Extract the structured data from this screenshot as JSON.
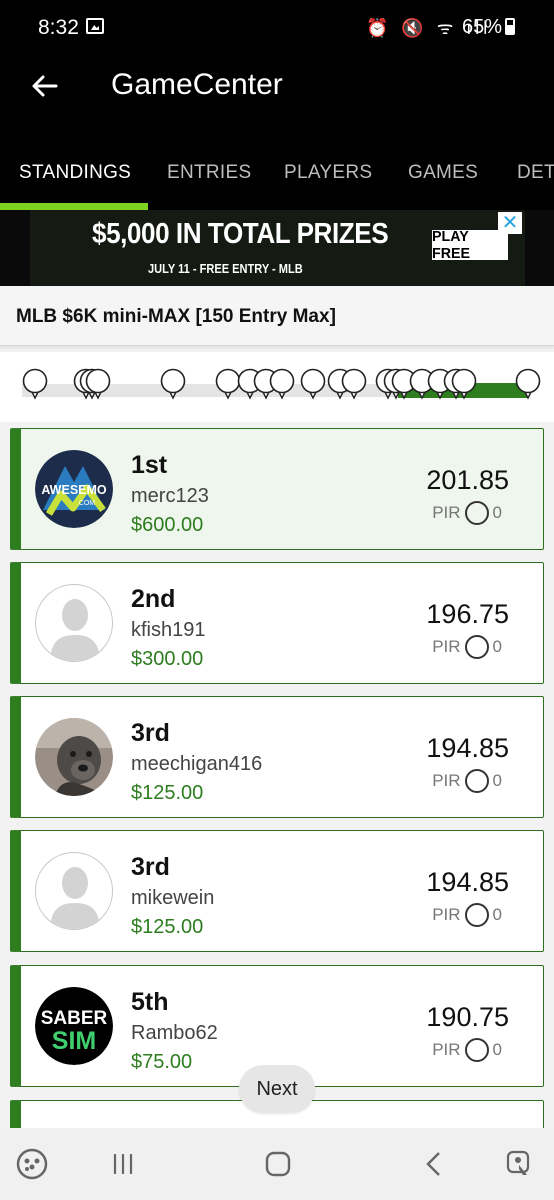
{
  "status_bar": {
    "time": "8:32",
    "icons": "⏰ 🔇 ᯤ ıll",
    "battery": "65%"
  },
  "app_bar": {
    "title": "GameCenter"
  },
  "tabs": [
    {
      "label": "STANDINGS",
      "active": true
    },
    {
      "label": "ENTRIES",
      "active": false
    },
    {
      "label": "PLAYERS",
      "active": false
    },
    {
      "label": "GAMES",
      "active": false
    },
    {
      "label": "DETAILS",
      "active": false
    }
  ],
  "ad": {
    "headline": "$5,000 IN TOTAL PRIZES",
    "subline": "JULY 11 - FREE ENTRY - MLB",
    "button": "PLAY FREE",
    "close": "✕"
  },
  "contest": {
    "name": "MLB $6K mini-MAX [150 Entry Max]"
  },
  "timeline": {
    "game_markers": 20,
    "progress_fraction": 0.26
  },
  "standings": [
    {
      "rank": "1st",
      "user": "merc123",
      "prize": "$600.00",
      "score": "201.85",
      "pir_label": "PIR",
      "pir_value": "0",
      "avatar": "awesemo-logo",
      "avatar_text": "AWESEMO",
      "avatar_subtext": ".COM"
    },
    {
      "rank": "2nd",
      "user": "kfish191",
      "prize": "$300.00",
      "score": "196.75",
      "pir_label": "PIR",
      "pir_value": "0",
      "avatar": "default-avatar"
    },
    {
      "rank": "3rd",
      "user": "meechigan416",
      "prize": "$125.00",
      "score": "194.85",
      "pir_label": "PIR",
      "pir_value": "0",
      "avatar": "dog-photo"
    },
    {
      "rank": "3rd",
      "user": "mikewein",
      "prize": "$125.00",
      "score": "194.85",
      "pir_label": "PIR",
      "pir_value": "0",
      "avatar": "default-avatar"
    },
    {
      "rank": "5th",
      "user": "Rambo62",
      "prize": "$75.00",
      "score": "190.75",
      "pir_label": "PIR",
      "pir_value": "0",
      "avatar": "sabersim-logo",
      "avatar_text": "SABER",
      "avatar_subtext": "SIM"
    }
  ],
  "next_button": "Next",
  "colors": {
    "accent_green": "#2e7d1f",
    "tab_indicator": "#7ed321",
    "header_bg": "#000000"
  }
}
